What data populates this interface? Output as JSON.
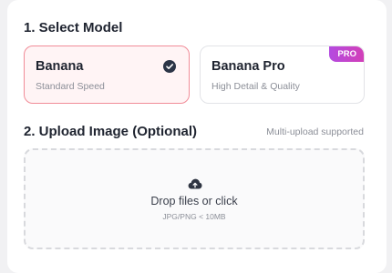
{
  "section1": {
    "title": "1. Select Model"
  },
  "models": [
    {
      "name": "Banana",
      "description": "Standard Speed",
      "selected": true,
      "accent_color": "#f18c98"
    },
    {
      "name": "Banana Pro",
      "description": "High Detail & Quality",
      "selected": false,
      "badge": "PRO",
      "badge_color": "#c445d0"
    }
  ],
  "section2": {
    "title": "2. Upload Image (Optional)",
    "hint": "Multi-upload supported"
  },
  "dropzone": {
    "icon": "cloud-upload-icon",
    "label": "Drop files or click",
    "sublabel": "JPG/PNG < 10MB"
  }
}
